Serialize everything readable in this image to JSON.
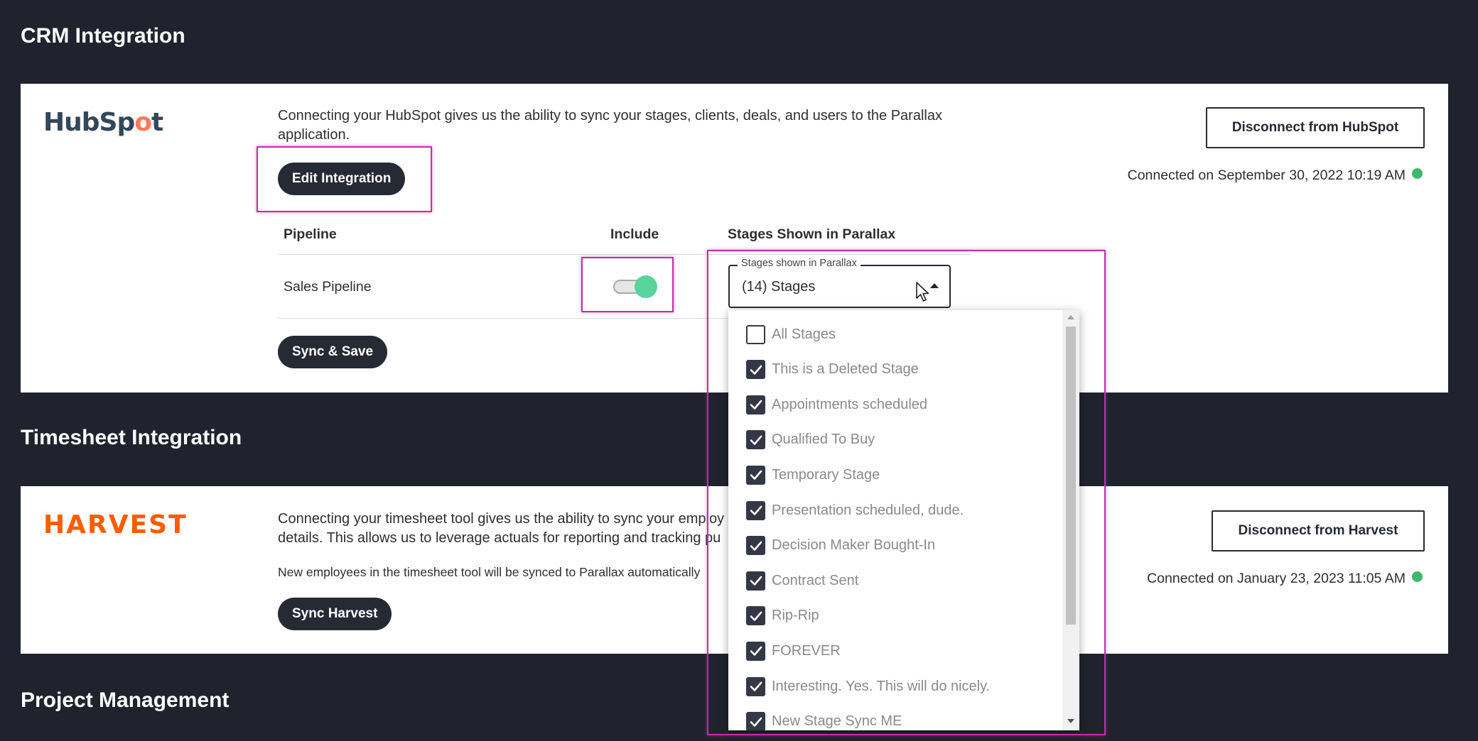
{
  "crm": {
    "title": "CRM Integration",
    "logo_text_a": "HubSp",
    "logo_text_b": "o",
    "logo_text_c": "t",
    "description": "Connecting your HubSpot gives us the ability to sync your stages, clients, deals, and users to the Parallax application.",
    "edit_button": "Edit Integration",
    "disconnect_button": "Disconnect from HubSpot",
    "connected_text": "Connected on September 30, 2022 10:19 AM",
    "status_color": "#3fb76c",
    "table": {
      "headers": [
        "Pipeline",
        "Include",
        "Stages Shown in Parallax"
      ],
      "rows": [
        {
          "pipeline": "Sales Pipeline",
          "include": true
        }
      ]
    },
    "stages_select": {
      "legend": "Stages shown in Parallax",
      "value": "(14) Stages",
      "options": [
        {
          "label": "All Stages",
          "checked": false
        },
        {
          "label": "This is a Deleted Stage",
          "checked": true
        },
        {
          "label": "Appointments scheduled",
          "checked": true
        },
        {
          "label": "Qualified To Buy",
          "checked": true
        },
        {
          "label": "Temporary Stage",
          "checked": true
        },
        {
          "label": "Presentation scheduled, dude.",
          "checked": true
        },
        {
          "label": "Decision Maker Bought-In",
          "checked": true
        },
        {
          "label": "Contract Sent",
          "checked": true
        },
        {
          "label": "Rip-Rip",
          "checked": true
        },
        {
          "label": "FOREVER",
          "checked": true
        },
        {
          "label": "Interesting. Yes. This will do nicely.",
          "checked": true
        },
        {
          "label": "New Stage Sync ME",
          "checked": true
        }
      ]
    },
    "sync_save_button": "Sync & Save"
  },
  "timesheet": {
    "title": "Timesheet Integration",
    "logo_text": "HARVEST",
    "description_line1": "Connecting your timesheet tool gives us the ability to sync your employ",
    "description_line2": "details. This allows us to leverage actuals for reporting and tracking pu",
    "note": "New employees in the timesheet tool will be synced to Parallax automatically",
    "sync_button": "Sync Harvest",
    "disconnect_button": "Disconnect from Harvest",
    "connected_text": "Connected on January 23, 2023 11:05 AM",
    "status_color": "#3fb76c"
  },
  "project_management": {
    "title": "Project Management"
  },
  "colors": {
    "background": "#20232d",
    "highlight": "#c42ea5",
    "toggle_on": "#59d39c",
    "button_dark": "#262a35",
    "hubspot_orange": "#ff7a59",
    "harvest_orange": "#fa5d00"
  }
}
